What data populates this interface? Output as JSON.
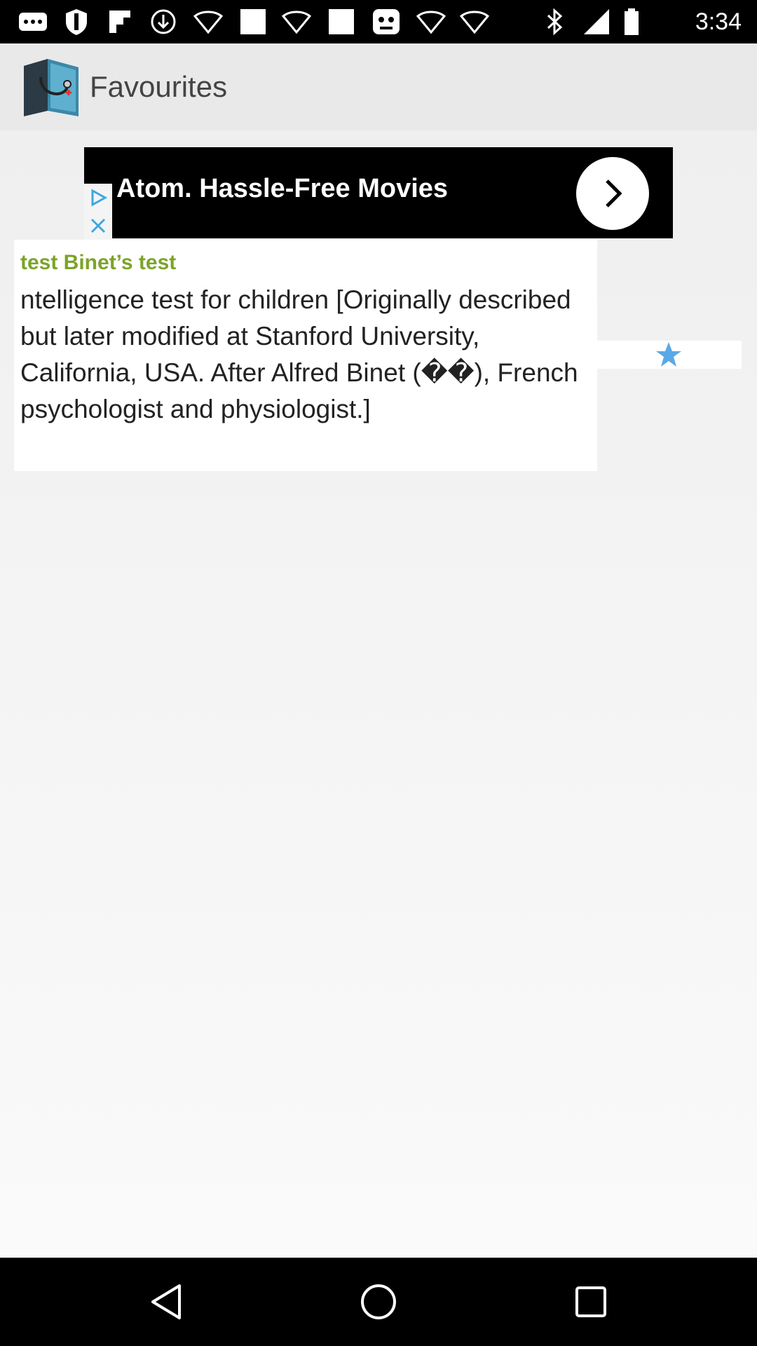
{
  "status_bar": {
    "time": "3:34",
    "icons": [
      "more-dots-icon",
      "shield-icon",
      "flipboard-icon",
      "download-icon",
      "wifi-icon",
      "image-icon",
      "wifi-icon",
      "image-icon",
      "game-icon",
      "wifi-icon",
      "wifi-icon",
      "bluetooth-icon",
      "signal-icon",
      "battery-icon"
    ]
  },
  "app_bar": {
    "title": "Favourites",
    "logo_icon": "medical-book-icon"
  },
  "ad": {
    "text": "Atom. Hassle-Free Movies",
    "arrow_icon": "chevron-right-icon",
    "choices_icon": "ad-choices-icon",
    "close_icon": "close-icon"
  },
  "favourite": {
    "term": "test Binet’s test",
    "definition": "ntelligence test for children [Originally described but later modified at Stanford University, California, USA. After Alfred Binet (��), French psychologist and physiologist.]",
    "star_icon": "star-icon"
  },
  "colors": {
    "term": "#7ba428",
    "star": "#5aa9e6",
    "app_bar": "#e9e9e9"
  },
  "nav_bar": {
    "icons": [
      "back-icon",
      "home-icon",
      "recents-icon"
    ]
  }
}
